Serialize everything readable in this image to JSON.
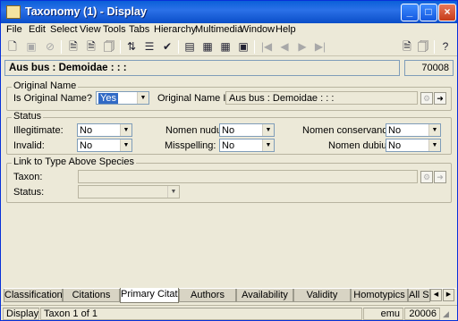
{
  "window": {
    "title": "Taxonomy (1) - Display"
  },
  "menu": [
    "File",
    "Edit",
    "Select",
    "View",
    "Tools",
    "Tabs",
    "Hierarchy",
    "Multimedia",
    "Window",
    "Help"
  ],
  "record": {
    "name": "Aus bus : Demoidae : : :",
    "number": "70008"
  },
  "original_name": {
    "legend": "Original Name",
    "is_original_label": "Is Original Name?",
    "is_original_value": "Yes",
    "original_is_label": "Original Name Is:",
    "original_is_value": "Aus bus : Demoidae : : :"
  },
  "status": {
    "legend": "Status",
    "illegitimate_label": "Illegitimate:",
    "illegitimate_value": "No",
    "invalid_label": "Invalid:",
    "invalid_value": "No",
    "nomen_nudum_label": "Nomen nudum:",
    "nomen_nudum_value": "No",
    "misspelling_label": "Misspelling:",
    "misspelling_value": "No",
    "nomen_conservandum_label": "Nomen conservandum:",
    "nomen_conservandum_value": "No",
    "nomen_dubium_label": "Nomen dubium:",
    "nomen_dubium_value": "No"
  },
  "link": {
    "legend": "Link to Type Above Species",
    "taxon_label": "Taxon:",
    "taxon_value": "",
    "status_label": "Status:",
    "status_value": ""
  },
  "tabs": [
    "Classification",
    "Citations",
    "Primary Citation",
    "Authors",
    "Availability",
    "Validity",
    "Homotypics",
    "All Sy"
  ],
  "active_tab": "Primary Citation",
  "statusbar": {
    "mode": "Display",
    "position": "Taxon 1 of 1",
    "user": "emu",
    "port": "20006"
  },
  "colors": {
    "title_bar": "#0a5fd8",
    "dialog": "#ece9d8",
    "selection": "#316ac5"
  }
}
